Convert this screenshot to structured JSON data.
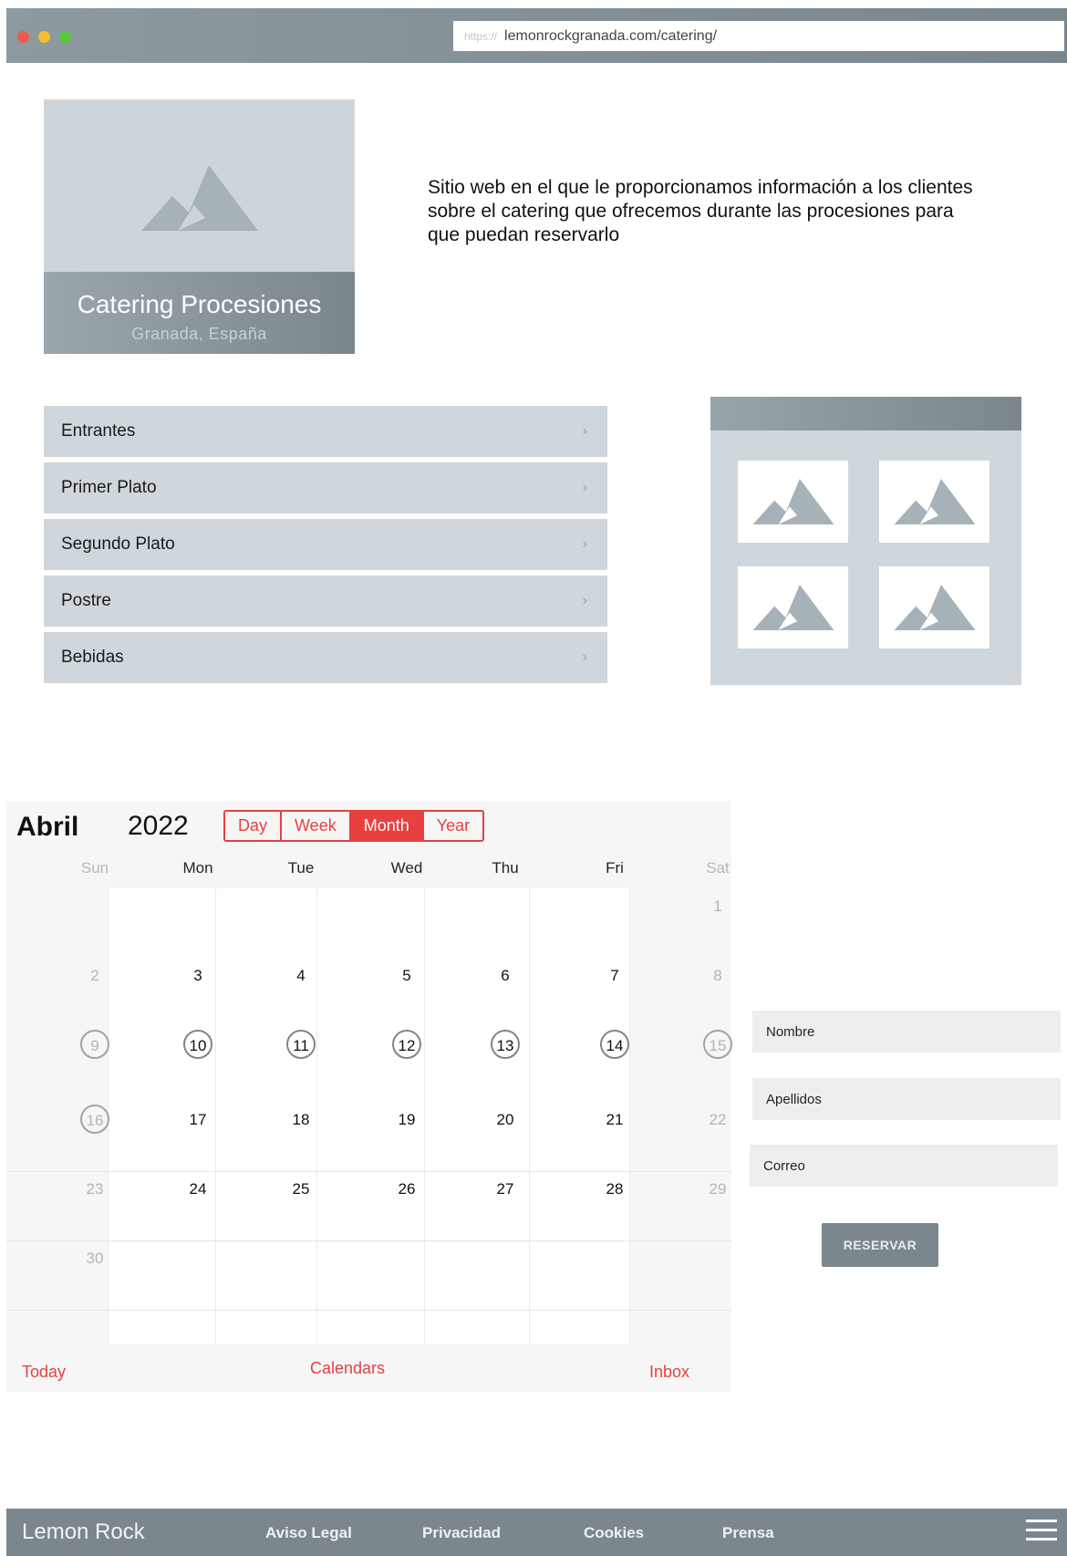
{
  "browser": {
    "url_scheme": "https://",
    "url": "lemonrockgranada.com/catering/"
  },
  "hero": {
    "title": "Catering Procesiones",
    "subtitle": "Granada, España"
  },
  "intro": "Sitio web en el que le proporcionamos información a los clientes sobre el catering que ofrecemos durante las procesiones para que puedan reservarlo",
  "menu": {
    "items": [
      {
        "label": "Entrantes"
      },
      {
        "label": "Primer Plato"
      },
      {
        "label": "Segundo Plato"
      },
      {
        "label": "Postre"
      },
      {
        "label": "Bebidas"
      }
    ]
  },
  "calendar": {
    "month": "Abril",
    "year": "2022",
    "views": [
      "Day",
      "Week",
      "Month",
      "Year"
    ],
    "active_view": "Month",
    "weekdays": [
      "Sun",
      "Mon",
      "Tue",
      "Wed",
      "Thu",
      "Fri",
      "Sat"
    ],
    "weeks": [
      [
        "",
        "",
        "",
        "",
        "",
        "",
        "1"
      ],
      [
        "2",
        "3",
        "4",
        "5",
        "6",
        "7",
        "8"
      ],
      [
        "9",
        "10",
        "11",
        "12",
        "13",
        "14",
        "15"
      ],
      [
        "16",
        "17",
        "18",
        "19",
        "20",
        "21",
        "22"
      ],
      [
        "23",
        "24",
        "25",
        "26",
        "27",
        "28",
        "29"
      ],
      [
        "30",
        "",
        "",
        "",
        "",
        "",
        ""
      ]
    ],
    "highlighted_days": [
      "9",
      "10",
      "11",
      "12",
      "13",
      "14",
      "15",
      "16"
    ],
    "footer": {
      "today": "Today",
      "calendars": "Calendars",
      "inbox": "Inbox"
    }
  },
  "form": {
    "nombre_placeholder": "Nombre",
    "apellidos_placeholder": "Apellidos",
    "correo_placeholder": "Correo",
    "submit_label": "RESERVAR"
  },
  "footer": {
    "brand": "Lemon Rock",
    "links": [
      "Aviso Legal",
      "Privacidad",
      "Cookies",
      "Prensa"
    ]
  },
  "colors": {
    "accent": "#e84040",
    "slate": "#7b878d",
    "panel": "#cfd7dc"
  }
}
